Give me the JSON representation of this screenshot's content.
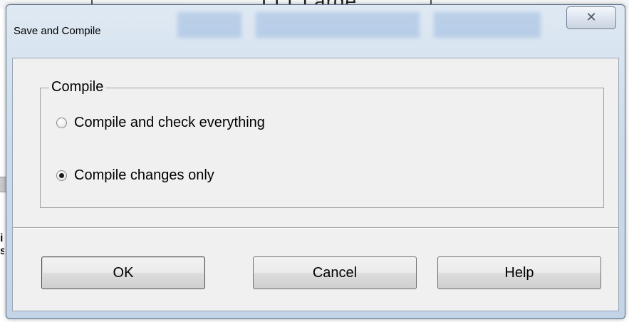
{
  "background": {
    "title_fragment": "TTT Large",
    "left_fragment_1": "i",
    "left_fragment_2": "s"
  },
  "dialog": {
    "title": "Save and Compile",
    "close_glyph": "✕"
  },
  "compile_group": {
    "label": "Compile",
    "options": [
      {
        "label": "Compile and check everything",
        "selected": false
      },
      {
        "label": "Compile changes only",
        "selected": true
      }
    ]
  },
  "buttons": {
    "ok": "OK",
    "cancel": "Cancel",
    "help": "Help"
  }
}
